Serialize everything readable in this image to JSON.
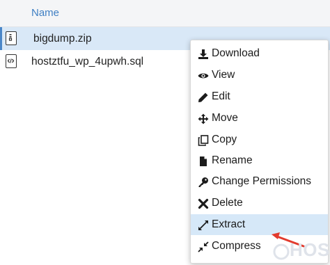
{
  "table": {
    "header_name": "Name",
    "files": [
      {
        "name": "bigdump.zip",
        "icon": "zip-file-icon",
        "selected": true
      },
      {
        "name": "hostztfu_wp_4upwh.sql",
        "icon": "code-file-icon",
        "selected": false
      }
    ]
  },
  "context_menu": {
    "items": [
      {
        "label": "Download",
        "icon": "download-icon"
      },
      {
        "label": "View",
        "icon": "eye-icon"
      },
      {
        "label": "Edit",
        "icon": "pencil-icon"
      },
      {
        "label": "Move",
        "icon": "move-arrows-icon"
      },
      {
        "label": "Copy",
        "icon": "copy-icon"
      },
      {
        "label": "Rename",
        "icon": "file-icon"
      },
      {
        "label": "Change Permissions",
        "icon": "key-icon"
      },
      {
        "label": "Delete",
        "icon": "x-icon"
      },
      {
        "label": "Extract",
        "icon": "expand-icon",
        "highlighted": true
      },
      {
        "label": "Compress",
        "icon": "compress-icon"
      }
    ]
  },
  "watermark": {
    "text": "HOST"
  },
  "colors": {
    "header_text": "#3f7fc3",
    "selected_row": "#d9e8f7",
    "menu_highlight": "#d6e8f8",
    "arrow": "#e23b2e"
  }
}
